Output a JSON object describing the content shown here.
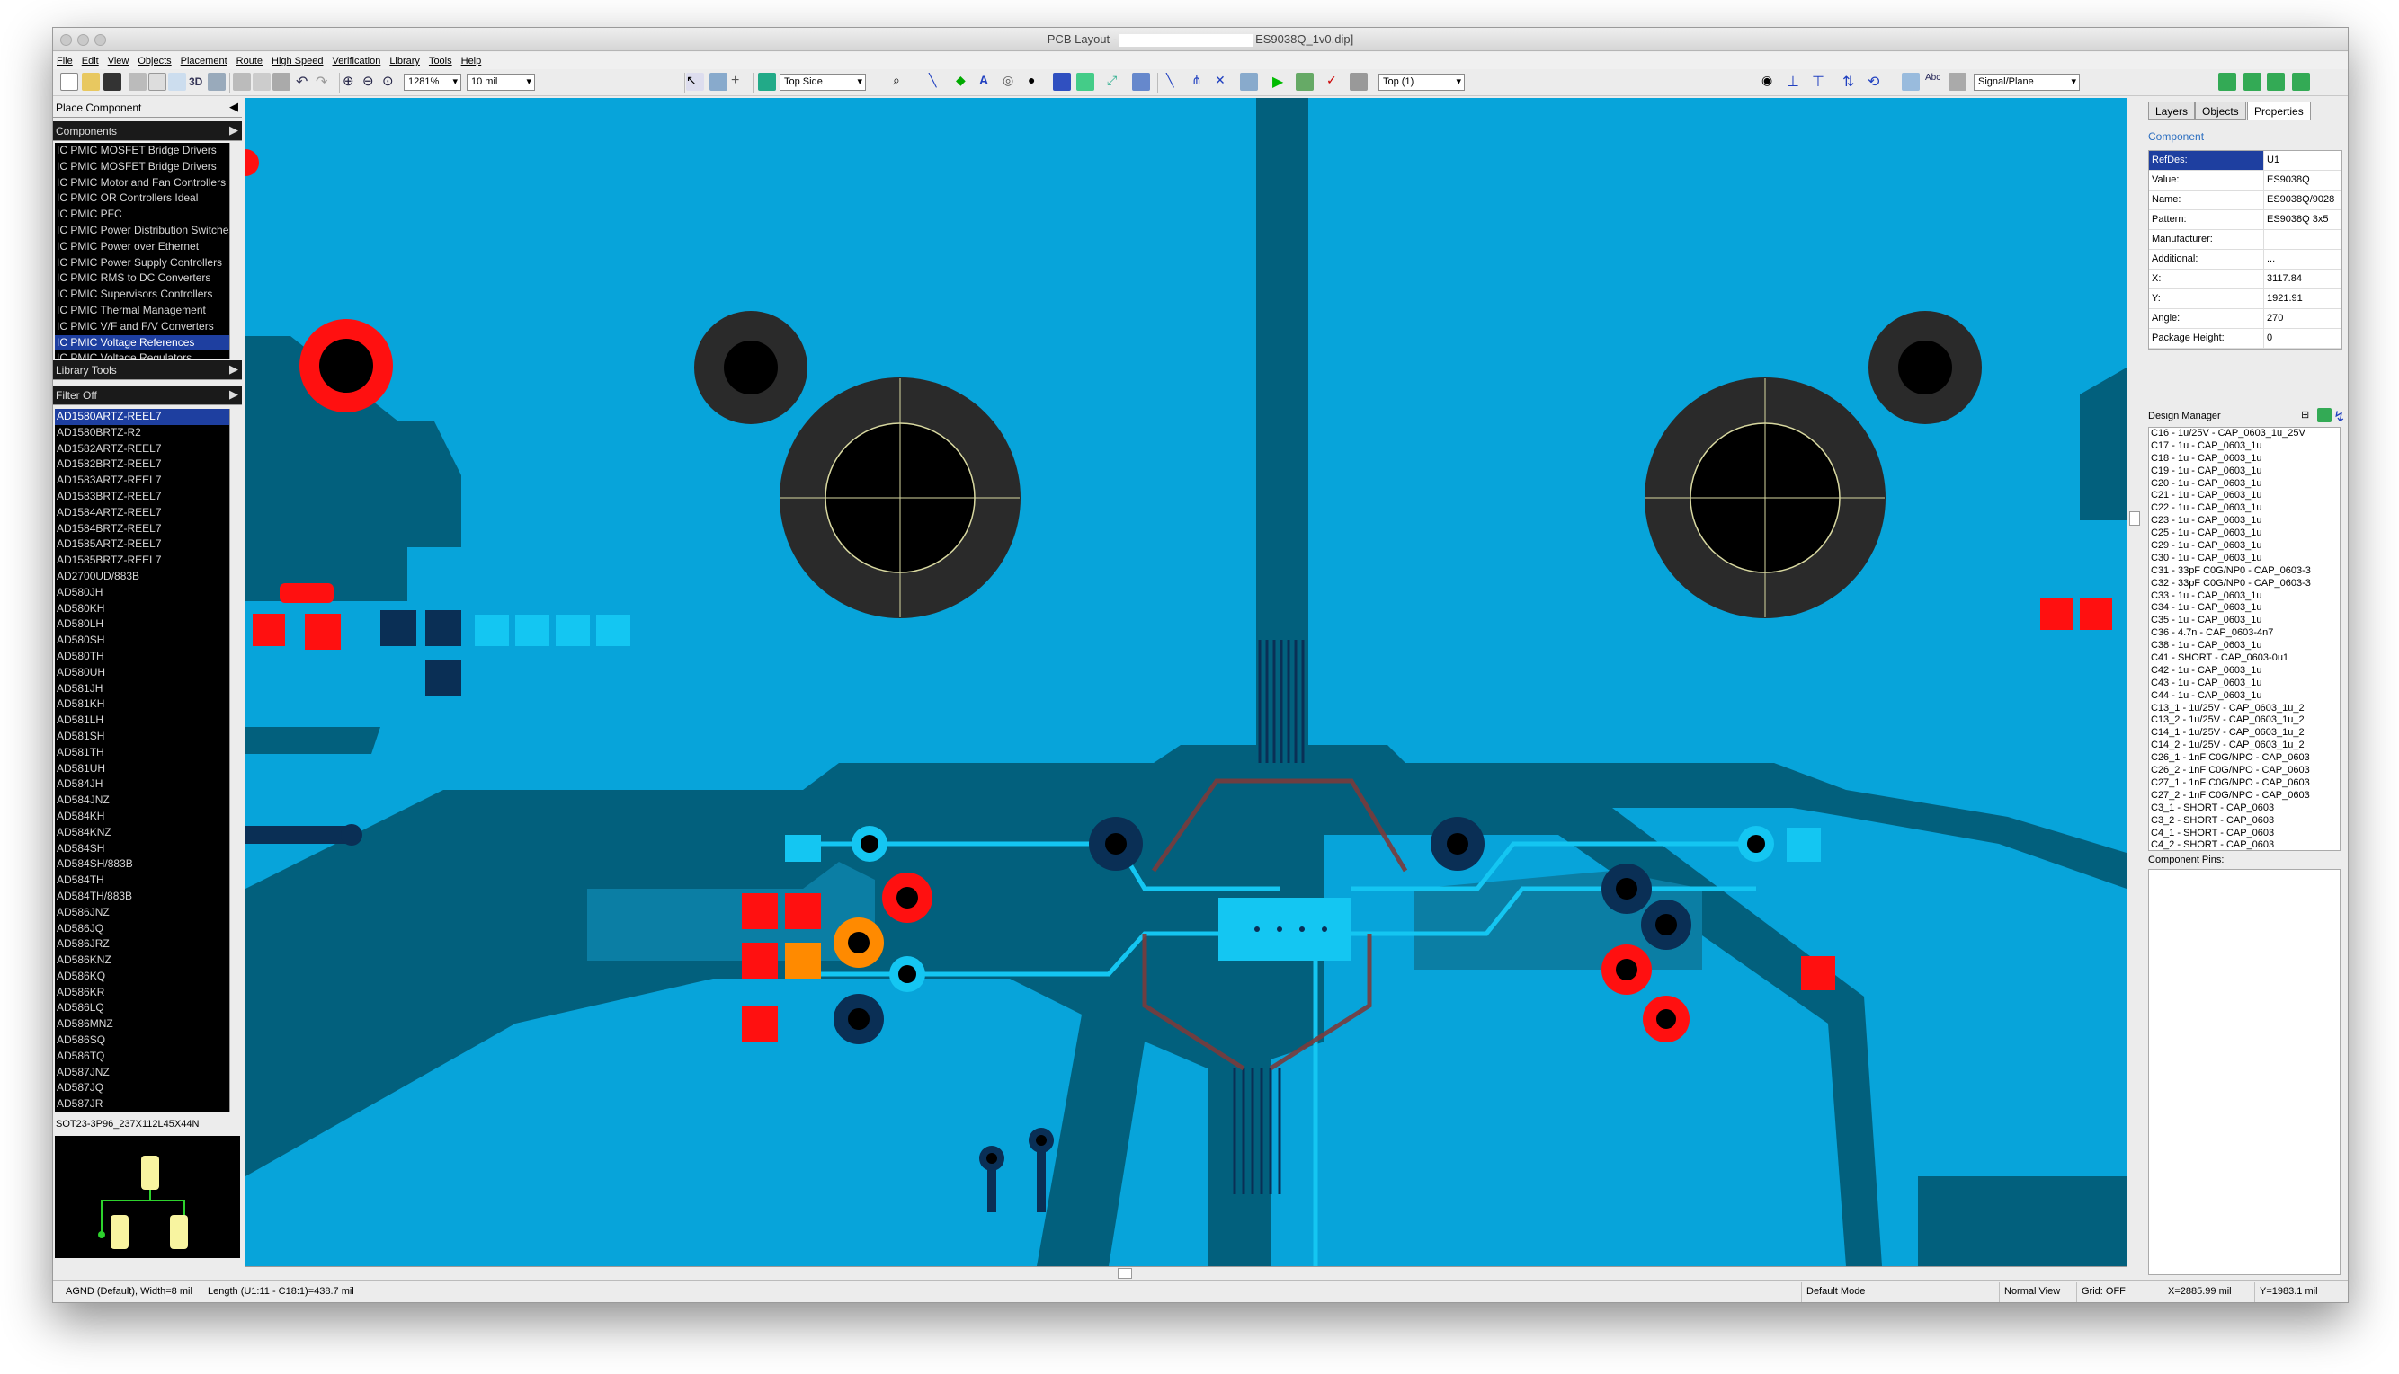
{
  "window": {
    "title": "PCB Layout -",
    "title_suffix": "ES9038Q_1v0.dip]"
  },
  "menu": [
    "File",
    "Edit",
    "View",
    "Objects",
    "Placement",
    "Route",
    "High Speed",
    "Verification",
    "Library",
    "Tools",
    "Help"
  ],
  "toolbar": {
    "zoom": "1281%",
    "grid": "10 mil",
    "side": "Top Side",
    "layer": "Top (1)",
    "layer_type": "Signal/Plane",
    "view3d": "3D"
  },
  "left_panel": {
    "place_component": "Place Component",
    "components": "Components",
    "categories": [
      "IC PMIC MOSFET Bridge Drivers",
      "IC PMIC MOSFET Bridge Drivers",
      "IC PMIC Motor and Fan Controllers",
      "IC PMIC OR Controllers Ideal",
      "IC PMIC PFC",
      "IC PMIC Power Distribution Switches",
      "IC PMIC Power over Ethernet",
      "IC PMIC Power Supply Controllers",
      "IC PMIC RMS to DC Converters",
      "IC PMIC Supervisors Controllers",
      "IC PMIC Thermal Management",
      "IC PMIC V/F and F/V Converters",
      "IC PMIC Voltage References",
      "IC PMIC Voltage Regulators"
    ],
    "selected_category": 12,
    "library_tools": "Library Tools",
    "filter": "Filter Off",
    "parts": [
      "AD1580ARTZ-REEL7",
      "AD1580BRTZ-R2",
      "AD1582ARTZ-REEL7",
      "AD1582BRTZ-REEL7",
      "AD1583ARTZ-REEL7",
      "AD1583BRTZ-REEL7",
      "AD1584ARTZ-REEL7",
      "AD1584BRTZ-REEL7",
      "AD1585ARTZ-REEL7",
      "AD1585BRTZ-REEL7",
      "AD2700UD/883B",
      "AD580JH",
      "AD580KH",
      "AD580LH",
      "AD580SH",
      "AD580TH",
      "AD580UH",
      "AD581JH",
      "AD581KH",
      "AD581LH",
      "AD581SH",
      "AD581TH",
      "AD581UH",
      "AD584JH",
      "AD584JNZ",
      "AD584KH",
      "AD584KNZ",
      "AD584SH",
      "AD584SH/883B",
      "AD584TH",
      "AD584TH/883B",
      "AD586JNZ",
      "AD586JQ",
      "AD586JRZ",
      "AD586KNZ",
      "AD586KQ",
      "AD586KR",
      "AD586LQ",
      "AD586MNZ",
      "AD586SQ",
      "AD586TQ",
      "AD587JNZ",
      "AD587JQ",
      "AD587JR"
    ],
    "selected_part": 0,
    "pattern": "SOT23-3P96_237X112L45X44N"
  },
  "right_panel": {
    "tabs": [
      "Layers",
      "Objects",
      "Properties"
    ],
    "active_tab": 2,
    "section": "Component",
    "properties": [
      {
        "k": "RefDes:",
        "v": "U1"
      },
      {
        "k": "Value:",
        "v": "ES9038Q"
      },
      {
        "k": "Name:",
        "v": "ES9038Q/9028"
      },
      {
        "k": "Pattern:",
        "v": "ES9038Q 3x5"
      },
      {
        "k": "Manufacturer:",
        "v": ""
      },
      {
        "k": "Additional:",
        "v": "..."
      },
      {
        "k": "X:",
        "v": "3117.84"
      },
      {
        "k": "Y:",
        "v": "1921.91"
      },
      {
        "k": "Angle:",
        "v": "270"
      },
      {
        "k": "Package Height:",
        "v": "0"
      }
    ],
    "design_manager": "Design Manager",
    "dm_items": [
      "C16 - 1u/25V - CAP_0603_1u_25V",
      "C17 - 1u - CAP_0603_1u",
      "C18 - 1u - CAP_0603_1u",
      "C19 - 1u - CAP_0603_1u",
      "C20 - 1u - CAP_0603_1u",
      "C21 - 1u - CAP_0603_1u",
      "C22 - 1u - CAP_0603_1u",
      "C23 - 1u - CAP_0603_1u",
      "C25 - 1u - CAP_0603_1u",
      "C29 - 1u - CAP_0603_1u",
      "C30 - 1u - CAP_0603_1u",
      "C31 - 33pF C0G/NP0 - CAP_0603-3",
      "C32 - 33pF C0G/NP0 - CAP_0603-3",
      "C33 - 1u - CAP_0603_1u",
      "C34 - 1u - CAP_0603_1u",
      "C35 - 1u - CAP_0603_1u",
      "C36 - 4.7n - CAP_0603-4n7",
      "C38 - 1u - CAP_0603_1u",
      "C41 - SHORT - CAP_0603-0u1",
      "C42 - 1u - CAP_0603_1u",
      "C43 - 1u - CAP_0603_1u",
      "C44 - 1u - CAP_0603_1u",
      "C13_1 - 1u/25V - CAP_0603_1u_2",
      "C13_2 - 1u/25V - CAP_0603_1u_2",
      "C14_1 - 1u/25V - CAP_0603_1u_2",
      "C14_2 - 1u/25V - CAP_0603_1u_2",
      "C26_1 - 1nF C0G/NPO - CAP_0603",
      "C26_2 - 1nF C0G/NPO - CAP_0603",
      "C27_1 - 1nF C0G/NPO - CAP_0603",
      "C27_2 - 1nF C0G/NPO - CAP_0603",
      "C3_1 - SHORT - CAP_0603",
      "C3_2 - SHORT - CAP_0603",
      "C4_1 - SHORT - CAP_0603",
      "C4_2 - SHORT - CAP_0603"
    ],
    "component_pins": "Component Pins:"
  },
  "status": {
    "net": "AGND (Default), Width=8 mil",
    "length": "Length (U1:11 - C18:1)=438.7 mil",
    "mode": "Default Mode",
    "view": "Normal View",
    "grid": "Grid: OFF",
    "x": "X=2885.99 mil",
    "y": "Y=1983.1 mil"
  },
  "colors": {
    "board": "#07a4da",
    "copper_dark": "#02607d",
    "trace_light": "#14c6f2",
    "pad_red": "#ff1010",
    "pad_orange": "#ff8a00",
    "via_dark": "#0a2f55",
    "silk": "#c8c060"
  }
}
